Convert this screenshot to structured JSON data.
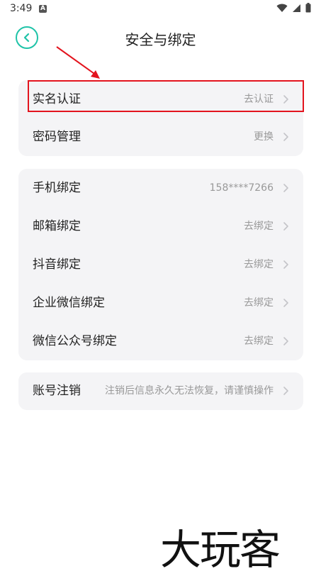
{
  "status_bar": {
    "time": "3:49",
    "notification_icon": "A",
    "icons": [
      "wifi-icon",
      "signal-icon",
      "battery-icon"
    ]
  },
  "header": {
    "title": "安全与绑定",
    "back_icon": "chevron-left-circle-icon"
  },
  "groups": [
    {
      "rows": [
        {
          "label": "实名认证",
          "value": "去认证"
        },
        {
          "label": "密码管理",
          "value": "更换"
        }
      ]
    },
    {
      "rows": [
        {
          "label": "手机绑定",
          "value": "158****7266"
        },
        {
          "label": "邮箱绑定",
          "value": "去绑定"
        },
        {
          "label": "抖音绑定",
          "value": "去绑定"
        },
        {
          "label": "企业微信绑定",
          "value": "去绑定"
        },
        {
          "label": "微信公众号绑定",
          "value": "去绑定"
        }
      ]
    },
    {
      "rows": [
        {
          "label": "账号注销",
          "value": "注销后信息永久无法恢复，请谨慎操作"
        }
      ]
    }
  ],
  "annotation": {
    "highlight_color": "#e3141e",
    "arrow_color": "#e3141e"
  },
  "accent_color": "#1fc3a8",
  "watermark": "大玩客"
}
